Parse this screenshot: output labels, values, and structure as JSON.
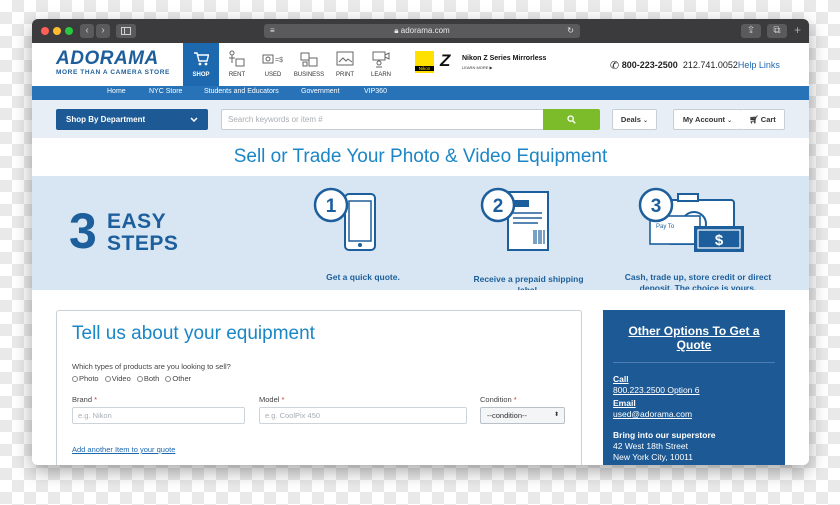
{
  "browser": {
    "url": "adorama.com",
    "lock_icon": "lock-icon",
    "back_icon": "chevron-left-icon",
    "forward_icon": "chevron-right-icon"
  },
  "brand": {
    "logo": "ADORAMA",
    "tagline": "MORE THAN A CAMERA STORE",
    "color": "#1d5f9c",
    "accent": "#1b86c6"
  },
  "nav": [
    {
      "label": "SHOP",
      "icon": "cart-icon",
      "active": true
    },
    {
      "label": "RENT",
      "icon": "rent-icon",
      "active": false
    },
    {
      "label": "USED",
      "icon": "used-icon",
      "active": false
    },
    {
      "label": "BUSINESS",
      "icon": "business-icon",
      "active": false
    },
    {
      "label": "PRINT",
      "icon": "print-icon",
      "active": false
    },
    {
      "label": "LEARN",
      "icon": "learn-icon",
      "active": false
    }
  ],
  "promo": {
    "title": "Nikon Z Series Mirrorless",
    "link": "LEARN MORE ▶",
    "badge": "Nikon",
    "mark": "Z"
  },
  "contact": {
    "phone_primary": "800-223-2500",
    "phone_secondary": "212.741.0052",
    "help": "Help Links"
  },
  "subnav": [
    "Home",
    "NYC Store",
    "Students and Educators",
    "Government",
    "VIP360"
  ],
  "search": {
    "department": "Shop By Department",
    "placeholder": "Search keywords or item #",
    "deals": "Deals",
    "account": "My Account",
    "cart": "Cart"
  },
  "headline": "Sell or Trade Your Photo & Video Equipment",
  "steps": {
    "number": "3",
    "line1": "EASY",
    "line2": "STEPS",
    "items": [
      {
        "num": "1",
        "caption": "Get a quick quote."
      },
      {
        "num": "2",
        "caption": "Receive a prepaid shipping label."
      },
      {
        "num": "3",
        "caption": "Cash, trade up, store credit or direct deposit. The choice is yours."
      }
    ]
  },
  "form": {
    "title": "Tell us about your equipment",
    "question": "Which types of products are you looking to sell?",
    "options": [
      "Photo",
      "Video",
      "Both",
      "Other"
    ],
    "brand_label": "Brand",
    "brand_placeholder": "e.g. Nikon",
    "model_label": "Model",
    "model_placeholder": "e.g. CoolPix 450",
    "condition_label": "Condition",
    "condition_value": "--condition--",
    "required_mark": "*",
    "add_link": "Add another Item to your quote"
  },
  "sidebar": {
    "title": "Other Options To Get a Quote",
    "call_label": "Call",
    "call_value": "800.223.2500 Option 6",
    "email_label": "Email",
    "email_value": "used@adorama.com",
    "store_label": "Bring into our superstore",
    "address1": "42 West 18th Street",
    "address2": "New York City, 10011"
  }
}
